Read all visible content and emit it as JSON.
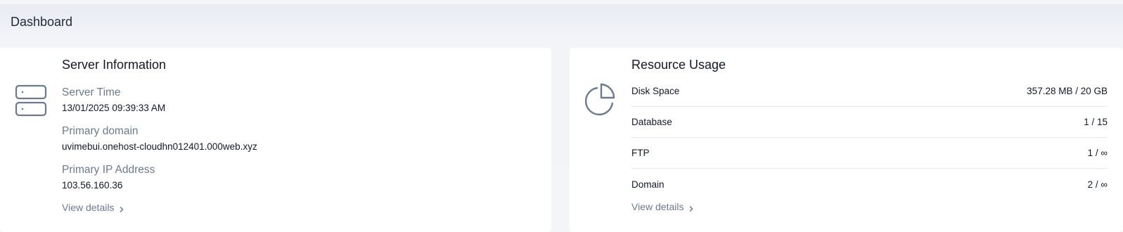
{
  "header": {
    "title": "Dashboard"
  },
  "server_info": {
    "title": "Server Information",
    "fields": [
      {
        "label": "Server Time",
        "value": "13/01/2025 09:39:33 AM"
      },
      {
        "label": "Primary domain",
        "value": "uvimebui.onehost-cloudhn012401.000web.xyz"
      },
      {
        "label": "Primary IP Address",
        "value": "103.56.160.36"
      }
    ],
    "view_details": "View details",
    "icon": "server-icon"
  },
  "resource_usage": {
    "title": "Resource Usage",
    "rows": [
      {
        "label": "Disk Space",
        "value": "357.28 MB / 20 GB"
      },
      {
        "label": "Database",
        "value": "1 / 15"
      },
      {
        "label": "FTP",
        "value": "1 / ∞"
      },
      {
        "label": "Domain",
        "value": "2 / ∞"
      }
    ],
    "view_details": "View details",
    "icon": "pie-chart-icon"
  }
}
